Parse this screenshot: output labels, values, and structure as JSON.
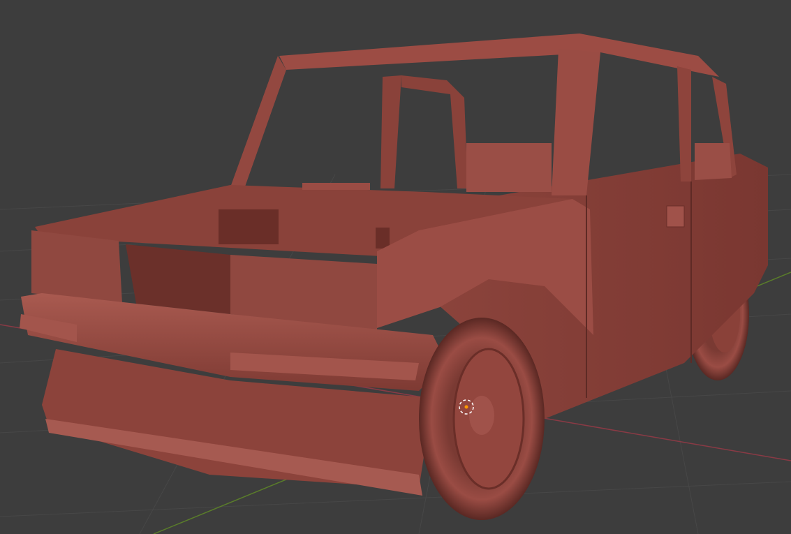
{
  "viewport": {
    "mode": "solid-shading",
    "background_color": "#3d3d3d",
    "grid_color": "#474747",
    "x_axis_color": "#8a3a45",
    "y_axis_color": "#5a7d2a"
  },
  "model": {
    "object": "car",
    "material_color": "#9a4a42",
    "shadow_color": "#5e2a25",
    "highlight_color": "#b5645a"
  },
  "icons": {
    "origin": "object-origin-icon",
    "cursor": "3d-cursor-icon"
  }
}
